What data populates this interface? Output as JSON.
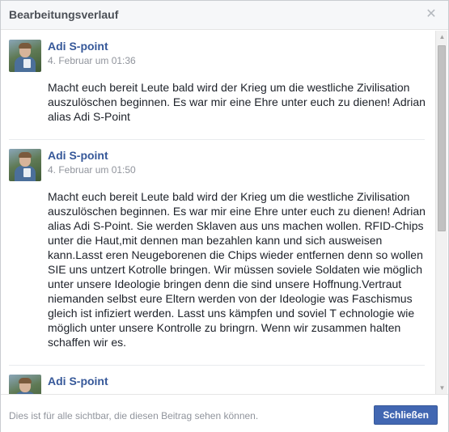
{
  "dialog": {
    "title": "Bearbeitungsverlauf",
    "close_icon": "close-icon"
  },
  "entries": [
    {
      "author": "Adi S-point",
      "timestamp": "4. Februar um 01:36",
      "text": "Macht euch bereit Leute bald wird der Krieg um die westliche Zivilisation auszulöschen beginnen. Es war mir eine Ehre unter euch zu dienen! Adrian alias Adi S-Point"
    },
    {
      "author": "Adi S-point",
      "timestamp": "4. Februar um 01:50",
      "text": "Macht euch bereit Leute bald wird der Krieg um die westliche Zivilisation auszulöschen beginnen. Es war mir eine Ehre unter euch zu dienen! Adrian alias Adi S-Point. Sie werden Sklaven aus uns machen wollen. RFID-Chips unter die Haut,mit dennen man bezahlen kann und sich ausweisen kann.Lasst eren Neugeborenen die Chips wieder entfernen denn so wollen SIE uns untzert Kotrolle bringen. Wir müssen soviele Soldaten wie möglich unter unsere Ideologie bringen denn die sind unsere Hoffnung.Vertraut niemanden selbst eure Eltern werden von der Ideologie was Faschismus gleich ist infiziert werden. Lasst uns kämpfen und soviel T echnologie wie möglich unter unsere Kontrolle zu bringrn. Wenn wir zusammen halten schaffen wir es."
    },
    {
      "author": "Adi S-point",
      "timestamp": "",
      "text": ""
    }
  ],
  "footer": {
    "visibility_text": "Dies ist für alle sichtbar, die diesen Beitrag sehen können.",
    "close_button_label": "Schließen"
  },
  "colors": {
    "author_link": "#365899",
    "primary_button": "#4267b2"
  }
}
